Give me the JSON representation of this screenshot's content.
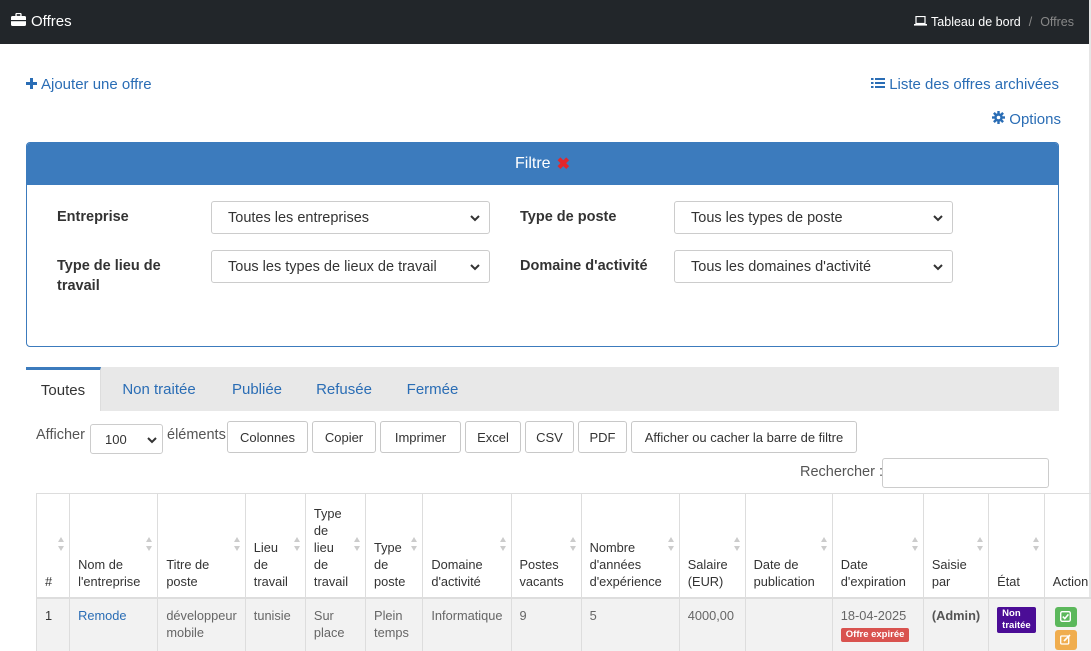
{
  "header": {
    "title": "Offres",
    "breadcrumb_home": "Tableau de bord",
    "breadcrumb_sep": "/",
    "breadcrumb_current": "Offres"
  },
  "actions": {
    "add_offer": "Ajouter une offre",
    "archived_list": "Liste des offres archivées",
    "options": "Options"
  },
  "filter": {
    "title": "Filtre",
    "company_label": "Entreprise",
    "company_value": "Toutes les entreprises",
    "post_type_label": "Type de poste",
    "post_type_value": "Tous les types de poste",
    "workplace_label": "Type de lieu de travail",
    "workplace_value": "Tous les types de lieux de travail",
    "domain_label": "Domaine d'activité",
    "domain_value": "Tous les domaines d'activité"
  },
  "tabs": [
    "Toutes",
    "Non traitée",
    "Publiée",
    "Refusée",
    "Fermée"
  ],
  "table_controls": {
    "show_label": "Afficher",
    "page_length": "100",
    "entries_label": "éléments",
    "buttons": [
      "Colonnes",
      "Copier",
      "Imprimer",
      "Excel",
      "CSV",
      "PDF",
      "Afficher ou cacher la barre de filtre"
    ],
    "search_label": "Rechercher :"
  },
  "table": {
    "columns": [
      "#",
      "Nom de l'entreprise",
      "Titre de poste",
      "Lieu de travail",
      "Type de lieu de travail",
      "Type de poste",
      "Domaine d'activité",
      "Postes vacants",
      "Nombre d'années d'expérience",
      "Salaire (EUR)",
      "Date de publication",
      "Date d'expiration",
      "Saisie par",
      "État",
      "Action"
    ],
    "rows": [
      {
        "num": "1",
        "company": "Remode",
        "job_title": "développeur mobile",
        "location": "tunisie",
        "workplace_type": "Sur place",
        "post_type": "Plein temps",
        "domain": "Informatique",
        "vacancies": "9",
        "experience": "5",
        "salary": "4000,00",
        "pub_date": "",
        "exp_date": "18-04-2025",
        "exp_badge": "Offre expirée",
        "entered_by": "(Admin)",
        "status": "Non traitée"
      }
    ]
  },
  "colors": {
    "topbar": "#22262a",
    "accent": "#3c7bbd",
    "link": "#2a6db5",
    "expired": "#d9534f",
    "status": "#4b0d96"
  }
}
